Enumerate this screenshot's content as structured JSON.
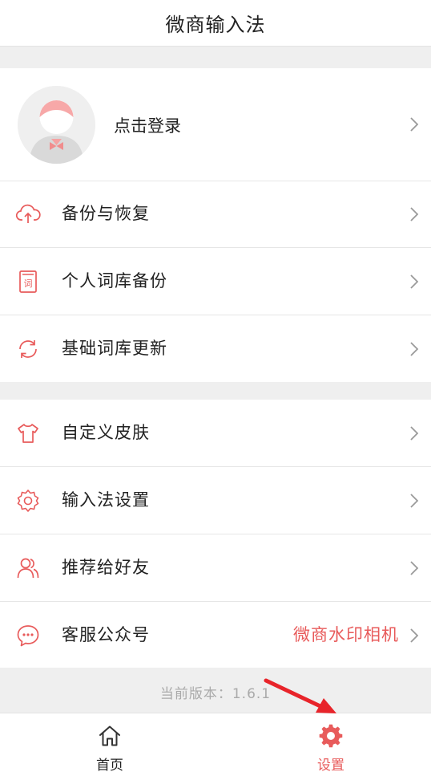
{
  "header": {
    "title": "微商输入法"
  },
  "login": {
    "label": "点击登录",
    "icon": "avatar-placeholder"
  },
  "menu_group_1": [
    {
      "label": "备份与恢复",
      "icon": "cloud-sync-icon"
    },
    {
      "label": "个人词库备份",
      "icon": "dictionary-icon"
    },
    {
      "label": "基础词库更新",
      "icon": "refresh-icon"
    }
  ],
  "menu_group_2": [
    {
      "label": "自定义皮肤",
      "icon": "tshirt-icon"
    },
    {
      "label": "输入法设置",
      "icon": "gear-icon"
    },
    {
      "label": "推荐给好友",
      "icon": "users-icon"
    },
    {
      "label": "客服公众号",
      "icon": "chat-icon",
      "value": "微商水印相机"
    }
  ],
  "version": {
    "text": "当前版本：1.6.1"
  },
  "tabbar": {
    "home": {
      "label": "首页",
      "icon": "home-icon"
    },
    "settings": {
      "label": "设置",
      "icon": "gear-icon",
      "active": true
    }
  },
  "colors": {
    "accent": "#e85b5b",
    "annotation_arrow": "#e8242a",
    "background": "#efefef"
  }
}
